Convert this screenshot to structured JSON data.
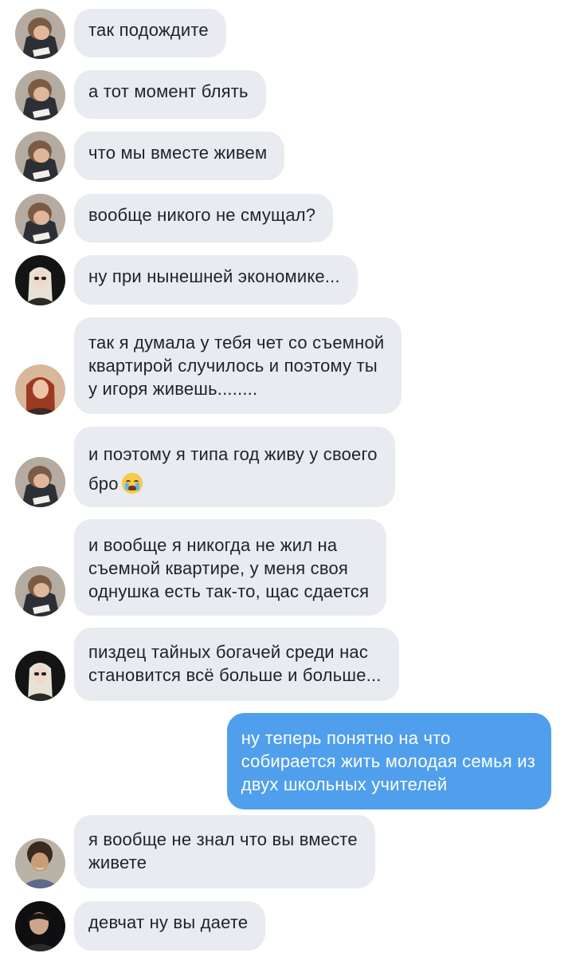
{
  "messages": [
    {
      "id": "m1",
      "text": "так подождите",
      "avatar": "boy-icon"
    },
    {
      "id": "m2",
      "text": "а тот момент блять",
      "avatar": "boy-icon"
    },
    {
      "id": "m3",
      "text": "что мы вместе живем",
      "avatar": "boy-icon"
    },
    {
      "id": "m4",
      "text": "вообще никого не смущал?",
      "avatar": "boy-icon"
    },
    {
      "id": "m5",
      "text": "ну при нынешней экономике...",
      "avatar": "blonde-icon"
    },
    {
      "id": "m6",
      "text": "так я думала у тебя чет со съемной\nквартирой случилось и поэтому ты\nу игоря живешь........",
      "avatar": "redhead-icon"
    },
    {
      "id": "m7",
      "text": "и поэтому я типа год живу у своего\nбро",
      "emoji": "crying-face-icon",
      "avatar": "boy-icon"
    },
    {
      "id": "m8",
      "text": "и вообще я никогда не жил на\nсъемной квартире, у меня своя\nоднушка есть так-то, щас сдается",
      "avatar": "boy-icon"
    },
    {
      "id": "m9",
      "text": "пиздец тайных богачей среди нас\nстановится всё больше и больше...",
      "avatar": "blonde-icon"
    },
    {
      "id": "m10",
      "text": "ну теперь понятно на что\nсобирается жить молодая семья из\nдвух школьных учителей",
      "outgoing": true
    },
    {
      "id": "m11",
      "text": "я вообще не знал что вы вместе\nживете",
      "avatar": "curly-icon"
    },
    {
      "id": "m12",
      "text": "девчат ну вы даете",
      "avatar": "dark-icon"
    }
  ],
  "colors": {
    "incoming_bubble": "#e8ebef",
    "outgoing_bubble": "#4f9fec",
    "incoming_text": "#1f2328",
    "outgoing_text": "#ffffff"
  }
}
